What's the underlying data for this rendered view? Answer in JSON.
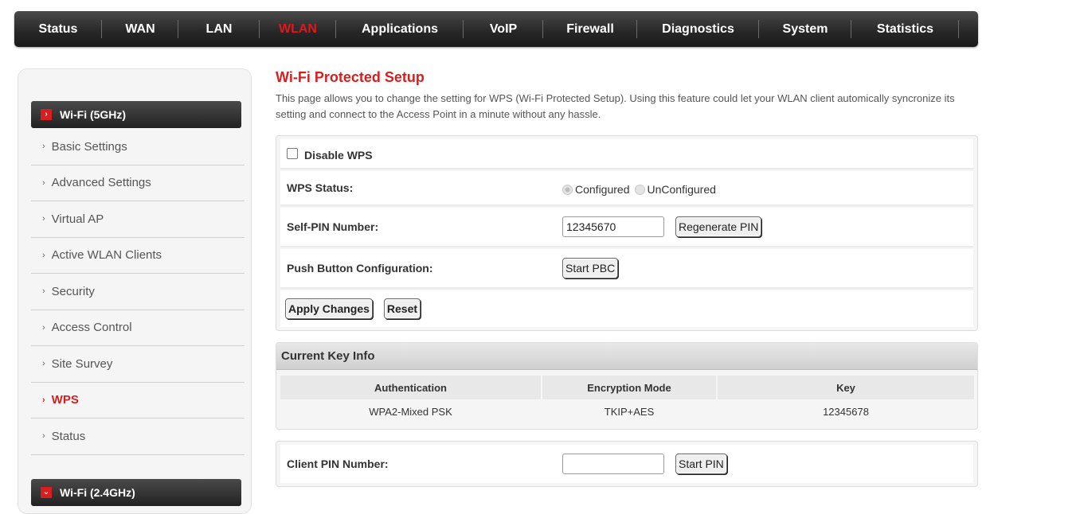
{
  "nav": {
    "items": [
      "Status",
      "WAN",
      "LAN",
      "WLAN",
      "Applications",
      "VoIP",
      "Firewall",
      "Diagnostics",
      "System",
      "Statistics"
    ],
    "active": "WLAN",
    "active_color": "#e0191b"
  },
  "sidebar": {
    "group1": {
      "label": "Wi-Fi (5GHz)",
      "icon": "chevron-right-icon"
    },
    "items": [
      "Basic Settings",
      "Advanced Settings",
      "Virtual AP",
      "Active WLAN Clients",
      "Security",
      "Access Control",
      "Site Survey",
      "WPS",
      "Status"
    ],
    "active_item": "WPS",
    "group2": {
      "label": "Wi-Fi (2.4GHz)",
      "icon": "chevron-down-icon"
    }
  },
  "page": {
    "title": "Wi-Fi Protected Setup",
    "description": "This page allows you to change the setting for WPS (Wi-Fi Protected Setup). Using this feature could let your WLAN client automically syncronize its setting and connect to the Access Point in a minute without any hassle."
  },
  "wps": {
    "disable_label": "Disable WPS",
    "disable_checked": false,
    "status_label": "WPS Status:",
    "status_options": [
      "Configured",
      "UnConfigured"
    ],
    "status_selected": "Configured",
    "self_pin_label": "Self-PIN Number:",
    "self_pin_value": "12345670",
    "regenerate_label": "Regenerate PIN",
    "pbc_label": "Push Button Configuration:",
    "start_pbc_label": "Start PBC",
    "apply_label": "Apply Changes",
    "reset_label": "Reset"
  },
  "key_info": {
    "title": "Current Key Info",
    "headers": [
      "Authentication",
      "Encryption Mode",
      "Key"
    ],
    "row": [
      "WPA2-Mixed PSK",
      "TKIP+AES",
      "12345678"
    ]
  },
  "client_pin": {
    "label": "Client PIN Number:",
    "value": "",
    "start_label": "Start PIN"
  },
  "colors": {
    "accent": "#d81e1e",
    "nav_bg": "#262626"
  }
}
